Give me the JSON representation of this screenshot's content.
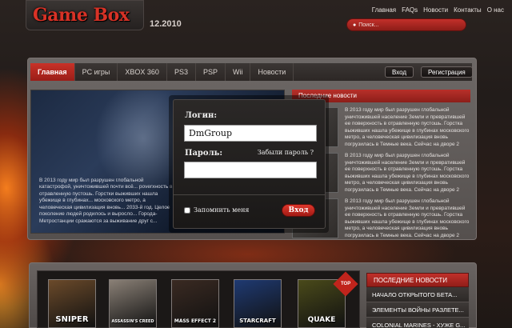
{
  "header": {
    "logo": {
      "part1": "Game ",
      "part2": "Box"
    },
    "date": "12.2010",
    "top_links": [
      "Главная",
      "FAQs",
      "Новости",
      "Контакты",
      "О нас"
    ],
    "search": {
      "placeholder": "Поиск..."
    }
  },
  "nav": {
    "items": [
      "Главная",
      "PC игры",
      "XBOX 360",
      "PS3",
      "PSP",
      "Wii",
      "Новости"
    ],
    "active_index": 0,
    "login_label": "Вход",
    "register_label": "Регистрация"
  },
  "hero": {
    "text": "В 2013 году мир был разрушен глобальной катастрофой, уничтожившей почти всё... poverхность в отравленную пустошь. Горстки выживших нашла убежище в глубинах... московского метро, а человеческая цивилизация вновь... 2033-й год. Целое поколение людей родилось и выросло... Города-Метростанции сражаются за выживание друг с..."
  },
  "news_panel": {
    "title": "Последние новости",
    "items": [
      "В 2013 году мир был разрушен глобальной уничтожившей население Земли и превратившей ее поверхность в отравленную пустошь. Горстка выживших нашла убежище в глубинах московского метро, а человеческая цивилизация вновь погрузилась в Темные века. Сейчас на дворе 2",
      "В 2013 году мир был разрушен глобальной уничтожившей население Земли и превратившей ее поверхность в отравленную пустошь. Горстка выживших нашла убежище в глубинах московского метро, а человеческая цивилизация вновь погрузилась в Темные века. Сейчас на дворе 2",
      "В 2013 году мир был разрушен глобальной уничтожившей население Земли и превратившей ее поверхность в отравленную пустошь. Горстка выживших нашла убежище в глубинах московского метро, а человеческая цивилизация вновь погрузилась в Темные века. Сейчас на дворе 2"
    ]
  },
  "modal": {
    "login_label": "Логин:",
    "login_value": "DmGroup",
    "password_label": "Пароль:",
    "forgot_label": "Забыли пароль ?",
    "remember_label": "Запомнить меня",
    "submit_label": "Вход"
  },
  "games": [
    {
      "title": "SNIPER",
      "color": "#6b4a2a"
    },
    {
      "title": "ASSASSIN'S CREED",
      "color": "#8a8076"
    },
    {
      "title": "MASS EFFECT 2",
      "color": "#3a2a22"
    },
    {
      "title": "STARCRAFT",
      "color": "#1f3a72"
    },
    {
      "title": "QUAKE",
      "color": "#4a4a1a"
    }
  ],
  "top_badge": "TOP",
  "side_news": {
    "title": "ПОСЛЕДНИЕ НОВОСТИ",
    "items": [
      "НАЧАЛО ОТКРЫТОГО БЕТА...",
      "ЭЛЕМЕНТЫ ВОЙНЫ РАЗЛЕТЕ...",
      "COLONIAL MARINES - ХУЖЕ G..."
    ]
  },
  "colors": {
    "accent": "#c8322a",
    "dark": "#1a1817"
  }
}
